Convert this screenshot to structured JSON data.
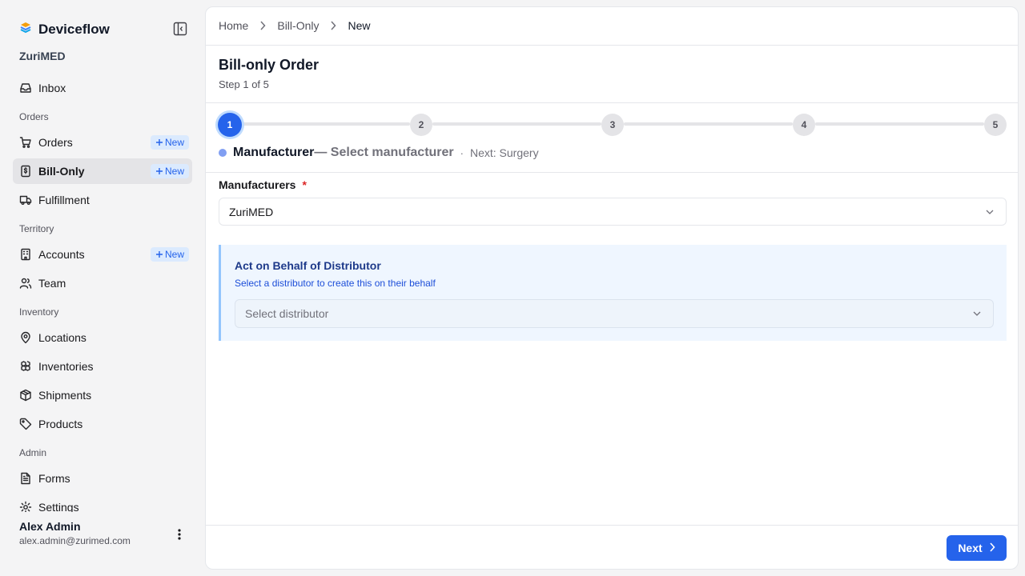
{
  "app": {
    "name": "Deviceflow",
    "org": "ZuriMED"
  },
  "sidebar": {
    "items": [
      {
        "type": "item",
        "label": "Inbox",
        "icon": "inbox-icon"
      },
      {
        "type": "group",
        "label": "Orders"
      },
      {
        "type": "item",
        "label": "Orders",
        "icon": "cart-icon",
        "badge": "New"
      },
      {
        "type": "item",
        "label": "Bill-Only",
        "icon": "bill-icon",
        "badge": "New",
        "active": true
      },
      {
        "type": "item",
        "label": "Fulfillment",
        "icon": "truck-icon"
      },
      {
        "type": "group",
        "label": "Territory"
      },
      {
        "type": "item",
        "label": "Accounts",
        "icon": "building-icon",
        "badge": "New"
      },
      {
        "type": "item",
        "label": "Team",
        "icon": "users-icon"
      },
      {
        "type": "group",
        "label": "Inventory"
      },
      {
        "type": "item",
        "label": "Locations",
        "icon": "map-pin-icon"
      },
      {
        "type": "item",
        "label": "Inventories",
        "icon": "boxes-icon"
      },
      {
        "type": "item",
        "label": "Shipments",
        "icon": "package-icon"
      },
      {
        "type": "item",
        "label": "Products",
        "icon": "tag-icon"
      },
      {
        "type": "group",
        "label": "Admin"
      },
      {
        "type": "item",
        "label": "Forms",
        "icon": "file-text-icon"
      },
      {
        "type": "item",
        "label": "Settings",
        "icon": "gear-icon"
      }
    ]
  },
  "user": {
    "name": "Alex Admin",
    "email": "alex.admin@zurimed.com"
  },
  "breadcrumb": {
    "home": "Home",
    "section": "Bill-Only",
    "current": "New"
  },
  "page": {
    "title": "Bill-only Order",
    "subtitle": "Step 1 of 5"
  },
  "stepper": {
    "steps": [
      "1",
      "2",
      "3",
      "4",
      "5"
    ],
    "active_index": 0,
    "current_name": "Manufacturer",
    "current_desc": "— Select manufacturer",
    "separator": "·",
    "next": "Next: Surgery"
  },
  "form": {
    "manufacturers_label": "Manufacturers",
    "required_mark": "*",
    "manufacturers_value": "ZuriMED",
    "behalf_title": "Act on Behalf of Distributor",
    "behalf_subtitle": "Select a distributor to create this on their behalf",
    "distributor_placeholder": "Select distributor"
  },
  "footer": {
    "next_label": "Next"
  },
  "colors": {
    "accent": "#2563eb",
    "badge_bg": "#dbeafe",
    "required": "#dc2626",
    "behalf_bg": "#eff6ff"
  }
}
